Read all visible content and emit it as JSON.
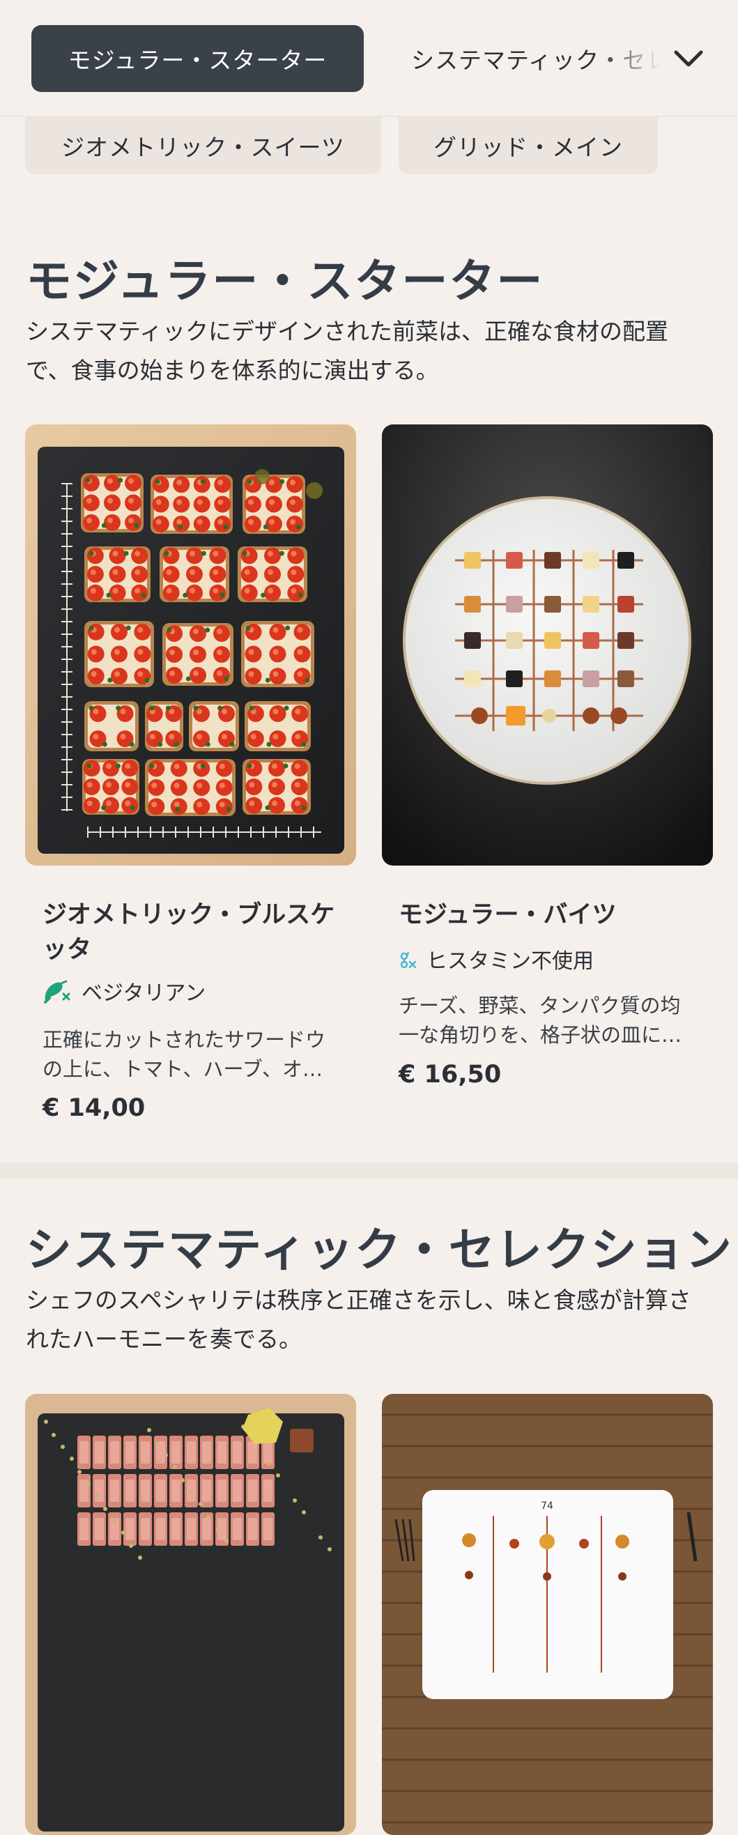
{
  "nav": {
    "active_tab": "モジュラー・スターター",
    "next_tab": "システマティック・セレクション",
    "chips": [
      "ジオメトリック・スイーツ",
      "グリッド・メイン"
    ]
  },
  "sections": [
    {
      "title": "モジュラー・スターター",
      "description": "システマティックにデザインされた前菜は、正確な食材の配置で、食事の始まりを体系的に演出する。",
      "items": [
        {
          "name": "ジオメトリック・ブルスケッタ",
          "tag": "ベジタリアン",
          "tag_icon": "vegetarian-icon",
          "description": "正確にカットされたサワードウの上に、トマト、ハーブ、オリーブオイルを幾何学的に配置。",
          "price": "€ 14,00"
        },
        {
          "name": "モジュラー・バイツ",
          "tag": "ヒスタミン不使用",
          "tag_icon": "histamine-free-icon",
          "description": "チーズ、野菜、タンパク質の均一な角切りを、格子状の皿に並べて。",
          "price": "€ 16,50"
        }
      ]
    },
    {
      "title": "システマティック・セレクション",
      "description": "シェフのスペシャリテは秩序と正確さを示し、味と食感が計算されたハーモニーを奏でる。"
    }
  ],
  "colors": {
    "background": "#f5f0ec",
    "active_tab": "#3a4149",
    "vegetarian_icon": "#1fa37a",
    "histamine_icon": "#49b7d6"
  }
}
